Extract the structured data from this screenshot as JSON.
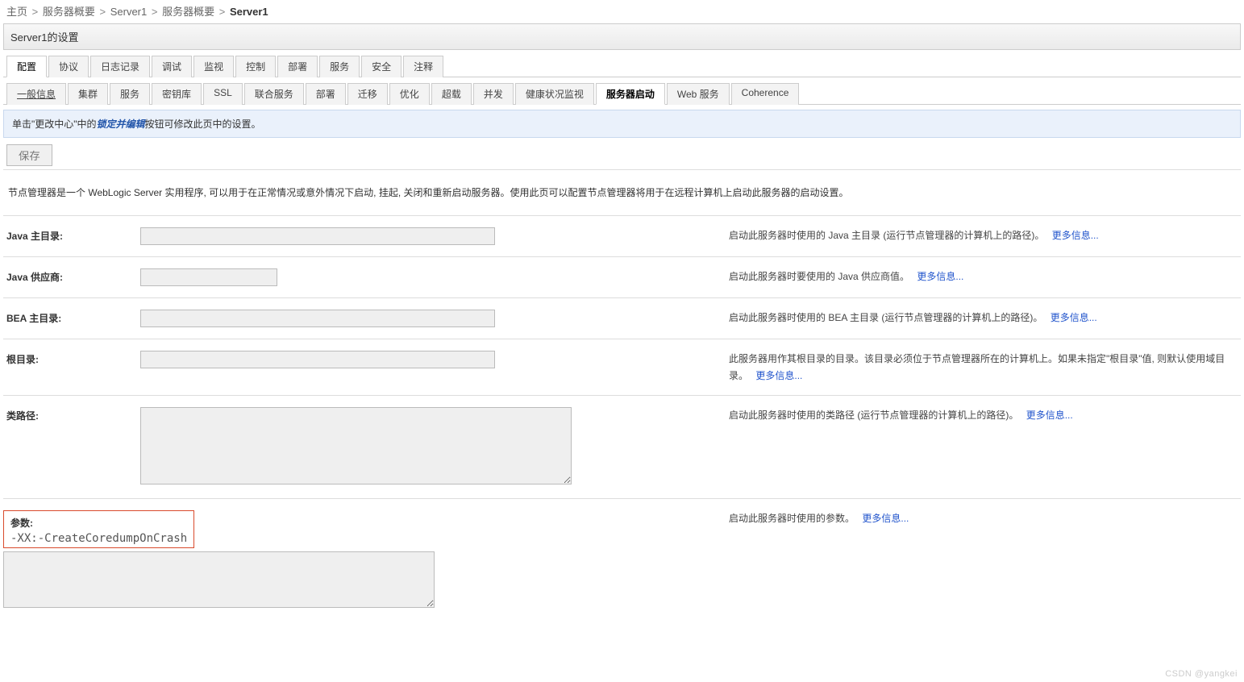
{
  "breadcrumb": {
    "items": [
      "主页",
      "服务器概要",
      "Server1",
      "服务器概要"
    ],
    "current": "Server1",
    "sep": ">"
  },
  "page_title": "Server1的设置",
  "tabs_main": [
    {
      "label": "配置",
      "active": true
    },
    {
      "label": "协议"
    },
    {
      "label": "日志记录"
    },
    {
      "label": "调试"
    },
    {
      "label": "监视"
    },
    {
      "label": "控制"
    },
    {
      "label": "部署"
    },
    {
      "label": "服务"
    },
    {
      "label": "安全"
    },
    {
      "label": "注释"
    }
  ],
  "tabs_sub": [
    {
      "label": "一般信息",
      "underline": true
    },
    {
      "label": "集群"
    },
    {
      "label": "服务"
    },
    {
      "label": "密钥库"
    },
    {
      "label": "SSL"
    },
    {
      "label": "联合服务"
    },
    {
      "label": "部署"
    },
    {
      "label": "迁移"
    },
    {
      "label": "优化"
    },
    {
      "label": "超载"
    },
    {
      "label": "并发"
    },
    {
      "label": "健康状况监视"
    },
    {
      "label": "服务器启动",
      "active": true
    },
    {
      "label": "Web 服务"
    },
    {
      "label": "Coherence"
    }
  ],
  "info_bar": {
    "prefix": "单击\"更改中心\"中的",
    "lock_text": "锁定并编辑",
    "suffix": "按钮可修改此页中的设置。"
  },
  "save_button": "保存",
  "description": "节点管理器是一个 WebLogic Server 实用程序, 可以用于在正常情况或意外情况下启动, 挂起, 关闭和重新启动服务器。使用此页可以配置节点管理器将用于在远程计算机上启动此服务器的启动设置。",
  "form": {
    "java_home": {
      "label": "Java 主目录:",
      "value": "",
      "desc": "启动此服务器时使用的 Java 主目录 (运行节点管理器的计算机上的路径)。",
      "more": "更多信息..."
    },
    "java_vendor": {
      "label": "Java 供应商:",
      "value": "",
      "desc": "启动此服务器时要使用的 Java 供应商值。",
      "more": "更多信息..."
    },
    "bea_home": {
      "label": "BEA 主目录:",
      "value": "",
      "desc": "启动此服务器时使用的 BEA 主目录 (运行节点管理器的计算机上的路径)。",
      "more": "更多信息..."
    },
    "root_dir": {
      "label": "根目录:",
      "value": "",
      "desc": "此服务器用作其根目录的目录。该目录必须位于节点管理器所在的计算机上。如果未指定\"根目录\"值, 则默认使用域目录。",
      "more": "更多信息..."
    },
    "classpath": {
      "label": "类路径:",
      "value": "",
      "desc": "启动此服务器时使用的类路径 (运行节点管理器的计算机上的路径)。",
      "more": "更多信息..."
    },
    "arguments": {
      "label": "参数:",
      "value": "-XX:-CreateCoredumpOnCrash",
      "desc": "启动此服务器时使用的参数。",
      "more": "更多信息..."
    }
  },
  "watermark": "CSDN @yangkei"
}
